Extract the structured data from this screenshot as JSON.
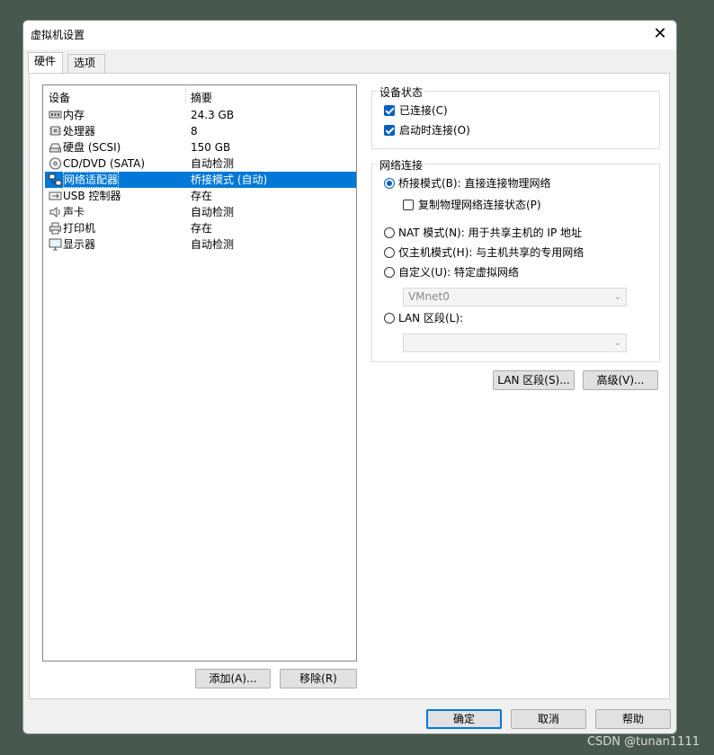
{
  "window": {
    "title": "虚拟机设置"
  },
  "tabs": [
    {
      "label": "硬件"
    },
    {
      "label": "选项"
    }
  ],
  "device_list": {
    "columns": [
      "设备",
      "摘要"
    ],
    "rows": [
      {
        "name": "内存",
        "summary": "24.3 GB",
        "icon": "memory-icon"
      },
      {
        "name": "处理器",
        "summary": "8",
        "icon": "cpu-icon"
      },
      {
        "name": "硬盘 (SCSI)",
        "summary": "150 GB",
        "icon": "hard-disk-icon"
      },
      {
        "name": "CD/DVD (SATA)",
        "summary": "自动检测",
        "icon": "cd-dvd-icon"
      },
      {
        "name": "网络适配器",
        "summary": "桥接模式 (自动)",
        "icon": "network-adapter-icon",
        "selected": true
      },
      {
        "name": "USB 控制器",
        "summary": "存在",
        "icon": "usb-icon"
      },
      {
        "name": "声卡",
        "summary": "自动检测",
        "icon": "speaker-icon"
      },
      {
        "name": "打印机",
        "summary": "存在",
        "icon": "printer-icon"
      },
      {
        "name": "显示器",
        "summary": "自动检测",
        "icon": "monitor-icon"
      }
    ],
    "add_label": "添加(A)...",
    "remove_label": "移除(R)"
  },
  "device_status": {
    "title": "设备状态",
    "connected_label": "已连接(C)",
    "connected_checked": true,
    "connect_on_power_label": "启动时连接(O)",
    "connect_on_power_checked": true
  },
  "network": {
    "title": "网络连接",
    "bridged_label": "桥接模式(B): 直接连接物理网络",
    "replicate_label": "复制物理网络连接状态(P)",
    "nat_label": "NAT 模式(N): 用于共享主机的 IP 地址",
    "hostonly_label": "仅主机模式(H): 与主机共享的专用网络",
    "custom_label": "自定义(U): 特定虚拟网络",
    "custom_value": "VMnet0",
    "lan_label": "LAN 区段(L):",
    "lan_value": "",
    "selected": "bridged"
  },
  "actions": {
    "lan_segments_label": "LAN 区段(S)...",
    "advanced_label": "高级(V)..."
  },
  "footer": {
    "ok_label": "确定",
    "cancel_label": "取消",
    "help_label": "帮助"
  },
  "watermark": "CSDN @tunan1111",
  "colors": {
    "accent": "#0078d7",
    "background": "#47584f"
  }
}
